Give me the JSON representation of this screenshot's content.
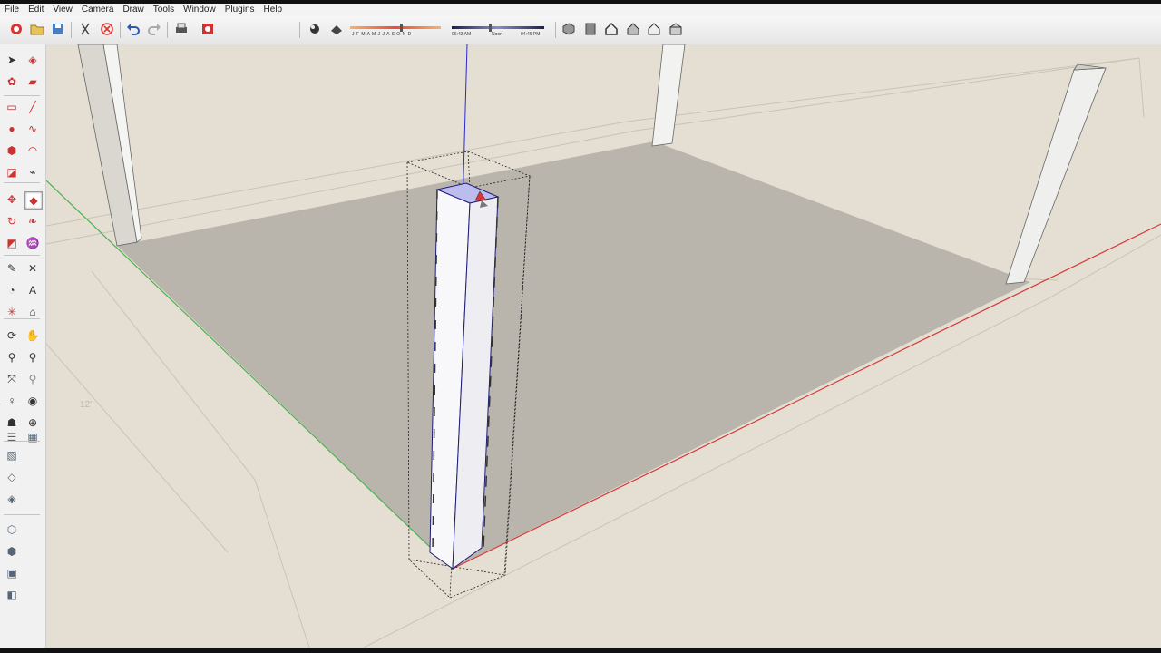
{
  "menu": [
    "File",
    "Edit",
    "View",
    "Camera",
    "Draw",
    "Tools",
    "Window",
    "Plugins",
    "Help"
  ],
  "shadow_settings": {
    "months_label": "J F M A M J J A S O N D",
    "start_time": "06:43 AM",
    "noon_label": "Noon",
    "end_time": "04:46 PM",
    "month_fraction": 0.55,
    "time_fraction": 0.4
  },
  "toolbar_icons": [
    "sketchup-logo-icon",
    "open-folder-icon",
    "save-icon",
    "cut-icon",
    "erase-icon",
    "undo-icon",
    "redo-icon",
    "print-icon",
    "model-info-icon",
    "shadows-icon",
    "fog-icon",
    "iso-view-icon",
    "top-view-icon",
    "front-view-icon",
    "right-view-icon",
    "back-view-icon",
    "left-view-icon"
  ],
  "left_tools": [
    "select-arrow-icon",
    "paint-bucket-icon",
    "make-component-icon",
    "eraser-icon",
    "rectangle-icon",
    "line-icon",
    "circle-icon",
    "freehand-icon",
    "polygon-icon",
    "arc-icon",
    "push-pull-icon",
    "offset-icon",
    "move-icon",
    "push-pull-active-icon",
    "rotate-icon",
    "follow-me-icon",
    "scale-icon",
    "offset-curve-icon",
    "tape-measure-icon",
    "dimension-icon",
    "protractor-icon",
    "text-icon",
    "axes-icon",
    "3d-text-icon",
    "orbit-icon",
    "pan-icon",
    "zoom-icon",
    "zoom-window-icon",
    "zoom-extents-icon",
    "previous-view-icon",
    "position-camera-icon",
    "look-around-icon",
    "walk-icon",
    "section-plane-icon",
    "sandbox-icon",
    "drape-icon",
    "stamp-icon",
    "xray-icon",
    "wireframe-icon",
    "hidden-line-icon",
    "shaded-icon",
    "shaded-texture-icon",
    "monochrome-icon"
  ],
  "measurement_label": "12'",
  "colors": {
    "ground": "#e4dfd2",
    "floor": "#b9b5ac",
    "axis_red": "#d63a3a",
    "axis_green": "#4caf50",
    "axis_blue": "#2b2bd6"
  }
}
